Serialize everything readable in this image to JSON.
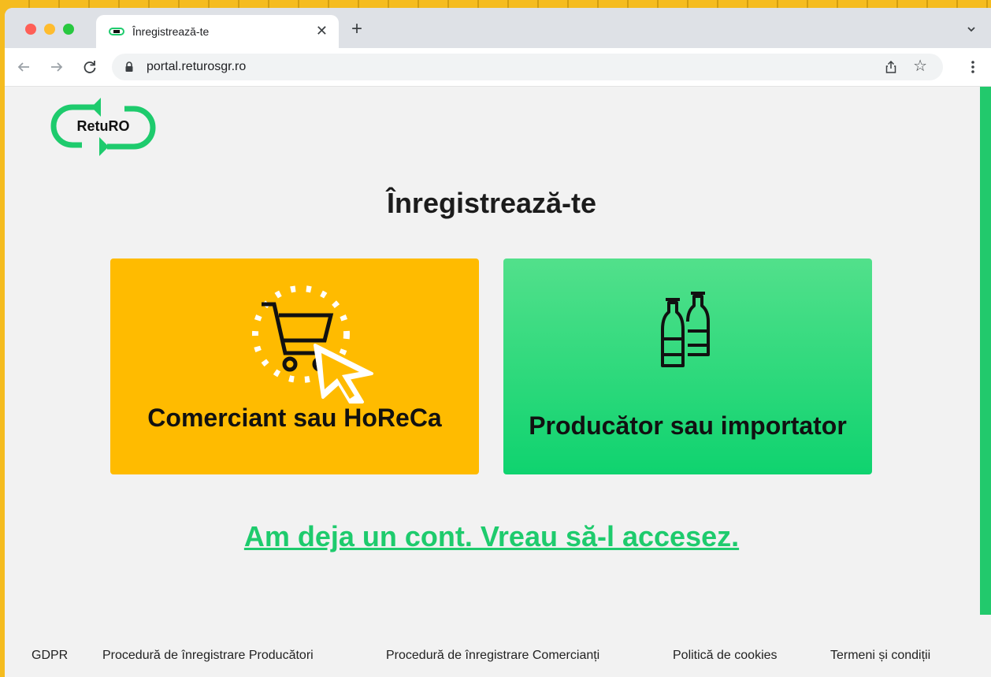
{
  "browser": {
    "tab_title": "Înregistrează-te",
    "url": "portal.returosgr.ro"
  },
  "page": {
    "logo_text": "RetuRO",
    "heading": "Înregistrează-te",
    "cards": [
      {
        "label": "Comerciant sau HoReCa",
        "icon": "shopping-cart-icon",
        "color": "#ffbb00"
      },
      {
        "label": "Producător sau importator",
        "icon": "bottles-icon",
        "color": "#1ed370"
      }
    ],
    "login_link": "Am deja un cont. Vreau să-l accesez.",
    "footer_links": [
      "GDPR",
      "Procedură de înregistrare Producători",
      "Procedură de înregistrare Comercianți",
      "Politică de cookies",
      "Termeni și condiții"
    ]
  },
  "colors": {
    "brand_green": "#1ecb6d",
    "brand_yellow": "#ffbb00"
  }
}
